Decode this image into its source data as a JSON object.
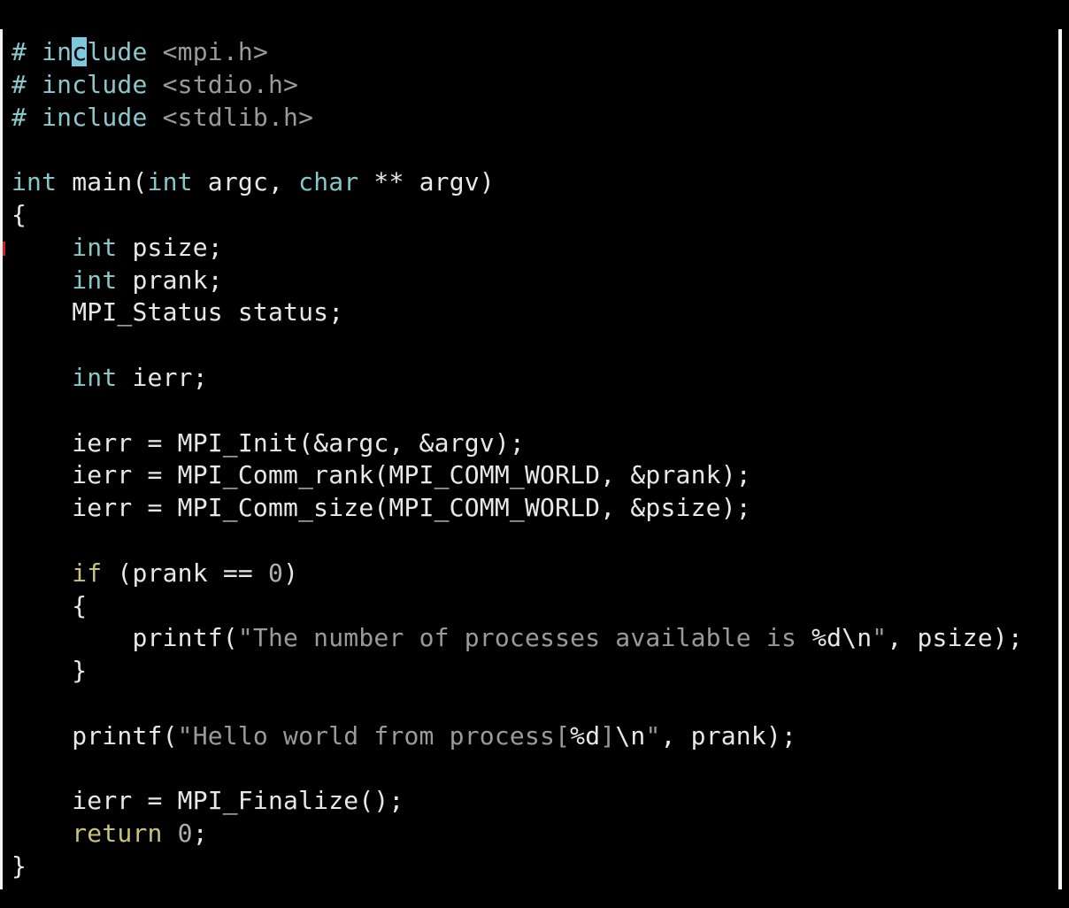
{
  "editor": {
    "lines": [
      [
        {
          "t": "# ",
          "c": "pp"
        },
        {
          "t": "in",
          "c": "pp"
        },
        {
          "t": "c",
          "c": "cursor"
        },
        {
          "t": "lude",
          "c": "pp"
        },
        {
          "t": " <mpi.h>",
          "c": "str"
        }
      ],
      [
        {
          "t": "# include",
          "c": "pp"
        },
        {
          "t": " <stdio.h>",
          "c": "str"
        }
      ],
      [
        {
          "t": "# include",
          "c": "pp"
        },
        {
          "t": " <stdlib.h>",
          "c": "str"
        }
      ],
      [],
      [
        {
          "t": "int",
          "c": "kw"
        },
        {
          "t": " main(",
          "c": ""
        },
        {
          "t": "int",
          "c": "kw"
        },
        {
          "t": " argc, ",
          "c": ""
        },
        {
          "t": "char",
          "c": "kw"
        },
        {
          "t": " ** argv)",
          "c": ""
        }
      ],
      [
        {
          "t": "{",
          "c": ""
        }
      ],
      [
        {
          "t": "    ",
          "c": ""
        },
        {
          "t": "int",
          "c": "kw"
        },
        {
          "t": " psize;",
          "c": ""
        }
      ],
      [
        {
          "t": "    ",
          "c": ""
        },
        {
          "t": "int",
          "c": "kw"
        },
        {
          "t": " prank;",
          "c": ""
        }
      ],
      [
        {
          "t": "    MPI_Status status;",
          "c": ""
        }
      ],
      [],
      [
        {
          "t": "    ",
          "c": ""
        },
        {
          "t": "int",
          "c": "kw"
        },
        {
          "t": " ierr;",
          "c": ""
        }
      ],
      [],
      [
        {
          "t": "    ierr = MPI_Init(&argc, &argv);",
          "c": ""
        }
      ],
      [
        {
          "t": "    ierr = MPI_Comm_rank(MPI_COMM_WORLD, &prank);",
          "c": ""
        }
      ],
      [
        {
          "t": "    ierr = MPI_Comm_size(MPI_COMM_WORLD, &psize);",
          "c": ""
        }
      ],
      [],
      [
        {
          "t": "    ",
          "c": ""
        },
        {
          "t": "if",
          "c": "ret"
        },
        {
          "t": " (prank == ",
          "c": ""
        },
        {
          "t": "0",
          "c": "num"
        },
        {
          "t": ")",
          "c": ""
        }
      ],
      [
        {
          "t": "    {",
          "c": ""
        }
      ],
      [
        {
          "t": "        printf(",
          "c": ""
        },
        {
          "t": "\"The number of processes available is ",
          "c": "str"
        },
        {
          "t": "%d\\n",
          "c": ""
        },
        {
          "t": "\"",
          "c": "str"
        },
        {
          "t": ", psize);",
          "c": ""
        }
      ],
      [
        {
          "t": "    }",
          "c": ""
        }
      ],
      [],
      [
        {
          "t": "    printf(",
          "c": ""
        },
        {
          "t": "\"Hello world from process[",
          "c": "str"
        },
        {
          "t": "%d",
          "c": ""
        },
        {
          "t": "]",
          "c": "str"
        },
        {
          "t": "\\n",
          "c": ""
        },
        {
          "t": "\"",
          "c": "str"
        },
        {
          "t": ", prank);",
          "c": ""
        }
      ],
      [],
      [
        {
          "t": "    ierr = MPI_Finalize();",
          "c": ""
        }
      ],
      [
        {
          "t": "    ",
          "c": ""
        },
        {
          "t": "return",
          "c": "ret"
        },
        {
          "t": " ",
          "c": ""
        },
        {
          "t": "0",
          "c": "num"
        },
        {
          "t": ";",
          "c": ""
        }
      ],
      [
        {
          "t": "}",
          "c": ""
        }
      ]
    ]
  },
  "colors": {
    "background": "#000000",
    "frame_border": "#f4f4f4",
    "keyword": "#86c8c8",
    "preprocessor": "#8ac8cc",
    "string": "#9a9a9a",
    "text": "#e8e8e8",
    "cursor": "#7cc8de",
    "control_keyword": "#c8c27a"
  }
}
